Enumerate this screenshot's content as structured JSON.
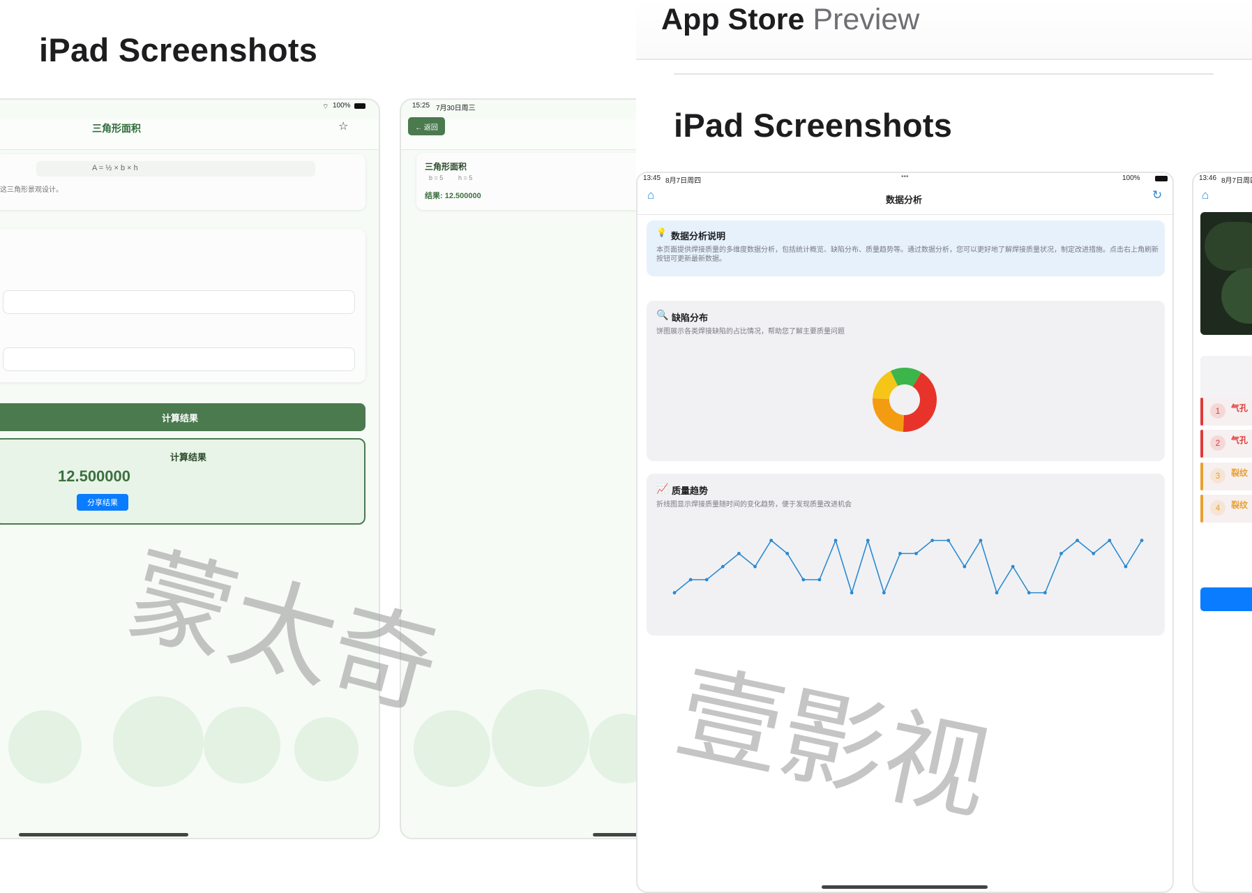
{
  "left": {
    "section_title": "iPad Screenshots",
    "screen1": {
      "status_right": "100%",
      "nav_title": "三角形面积",
      "formula": "A = ½ × b × h",
      "description": "这三角形景观设计。",
      "calculate_button": "计算结果",
      "result_heading": "计算结果",
      "result_value": "12.500000",
      "share_button": "分享结果"
    },
    "screen2": {
      "status_time": "15:25",
      "status_date": "7月30日周三",
      "back_button": "← 返回",
      "history_title": "三角形面积",
      "history_b": "b = 5",
      "history_h": "h = 5",
      "history_result": "结果: 12.500000"
    },
    "watermark": "蒙太奇"
  },
  "right": {
    "store_title_bold": "App Store",
    "store_title_light": "Preview",
    "section_title": "iPad Screenshots",
    "screen": {
      "status_time": "13:45",
      "status_date": "8月7日周四",
      "status_dots": "•••",
      "status_battery": "100%",
      "nav_title": "数据分析",
      "info_title": "数据分析说明",
      "info_body": "本页面提供焊接质量的多维度数据分析，包括统计概览、缺陷分布、质量趋势等。通过数据分析，您可以更好地了解焊接质量状况，制定改进措施。点击右上角刷新按钮可更新最新数据。",
      "defect_title": "缺陷分布",
      "defect_desc": "饼图展示各类焊接缺陷的占比情况，帮助您了解主要质量问题",
      "trend_title": "质量趋势",
      "trend_desc": "折线图显示焊接质量随时间的变化趋势，便于发现质量改进机会"
    },
    "screen_next": {
      "status_time": "13:46",
      "status_date": "8月7日周四",
      "items": [
        {
          "num": "1",
          "label": "气孔",
          "color": "#e03a3a"
        },
        {
          "num": "2",
          "label": "气孔",
          "color": "#e03a3a"
        },
        {
          "num": "3",
          "label": "裂纹",
          "color": "#e8a030"
        },
        {
          "num": "4",
          "label": "裂纹",
          "color": "#e8a030"
        }
      ]
    },
    "watermark": "壹影视"
  },
  "colors": {
    "green_primary": "#4a7a4e",
    "blue_primary": "#0a7cff",
    "info_panel": "#e6f1fc",
    "chart_line": "#2a8ad0"
  },
  "chart_data": [
    {
      "type": "pie",
      "title": "",
      "segments": [
        {
          "label": "",
          "value": 0.42,
          "color": "#e8332a"
        },
        {
          "label": "",
          "value": 0.25,
          "color": "#f39c12"
        },
        {
          "label": "",
          "value": 0.17,
          "color": "#f5c518"
        },
        {
          "label": "",
          "value": 0.16,
          "color": "#3cb54a"
        }
      ],
      "donut": true
    },
    {
      "type": "line",
      "title": "",
      "xlabel": "",
      "ylabel": "",
      "grid": false,
      "series": [
        {
          "values": [
            2,
            3,
            3,
            4,
            5,
            4,
            6,
            5,
            3,
            3,
            6,
            2,
            6,
            2,
            5,
            5,
            6,
            6,
            4,
            6,
            2,
            4,
            2,
            2,
            5,
            6,
            5,
            6,
            4,
            6
          ]
        }
      ]
    }
  ]
}
